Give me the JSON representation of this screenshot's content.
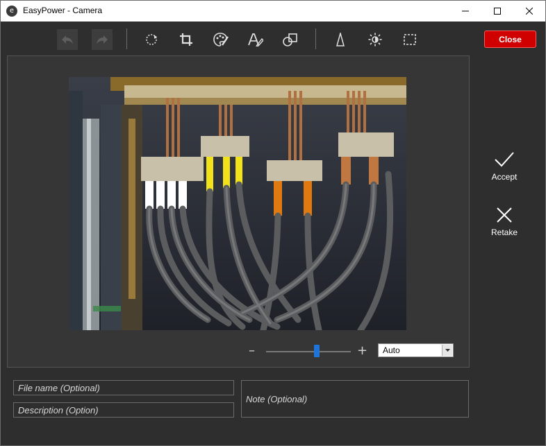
{
  "window": {
    "title": "EasyPower - Camera",
    "app_icon_letter": "e",
    "controls": [
      "minimize",
      "maximize",
      "close"
    ]
  },
  "toolbar": {
    "buttons": [
      {
        "name": "undo-icon",
        "enabled": false
      },
      {
        "name": "redo-icon",
        "enabled": false
      },
      {
        "name": "rotate-icon",
        "enabled": true
      },
      {
        "name": "crop-icon",
        "enabled": true
      },
      {
        "name": "palette-icon",
        "enabled": true
      },
      {
        "name": "text-annotate-icon",
        "enabled": true
      },
      {
        "name": "shapes-icon",
        "enabled": true
      },
      {
        "name": "sharpen-icon",
        "enabled": true
      },
      {
        "name": "brightness-icon",
        "enabled": true
      },
      {
        "name": "select-region-icon",
        "enabled": true
      }
    ],
    "close_label": "Close",
    "close_color": "#d10000"
  },
  "image": {
    "description_icon": "photo-electrical-cabinet-cables"
  },
  "zoom": {
    "minus_label": "–",
    "plus_label": "+",
    "level_fraction": 0.6,
    "selected": "Auto",
    "accent": "#1e74d8"
  },
  "actions": {
    "accept_label": "Accept",
    "retake_label": "Retake"
  },
  "fields": {
    "file_name_placeholder": "File name (Optional)",
    "description_placeholder": "Description (Option)",
    "note_placeholder": "Note (Optional)"
  }
}
